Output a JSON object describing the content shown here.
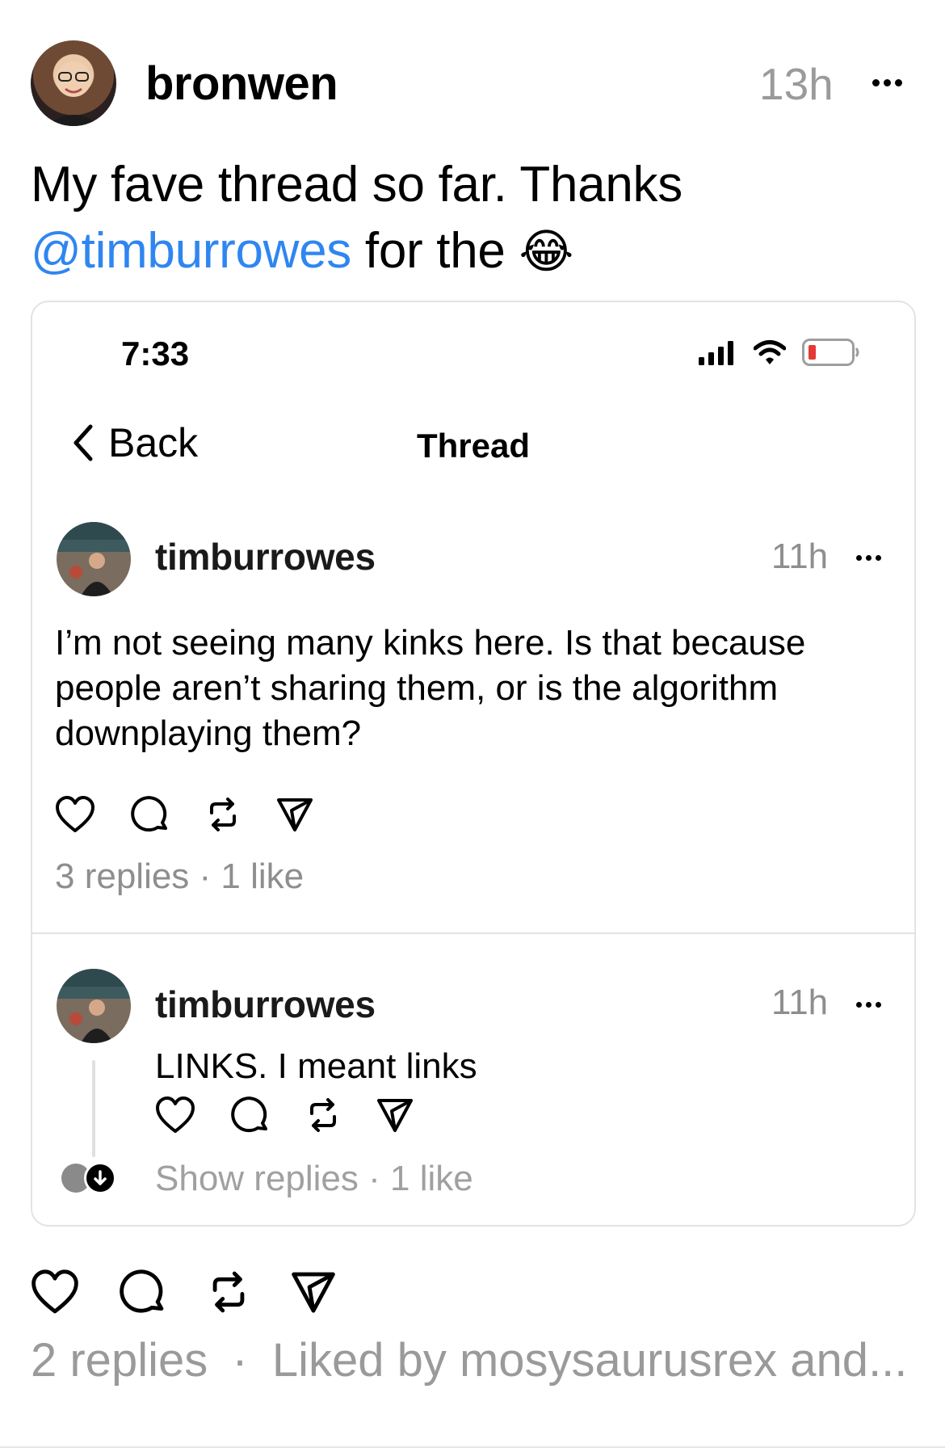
{
  "post": {
    "author": "bronwen",
    "time": "13h",
    "text_line1": "My fave thread so far. Thanks",
    "mention": "@timburrowes",
    "text_line2_rest": "for the",
    "emoji": "😂",
    "stats": {
      "replies": "2 replies",
      "separator": "·",
      "liked_by": "Liked by mosysaurusrex and..."
    }
  },
  "screenshot": {
    "status_time": "7:33",
    "nav": {
      "back_label": "Back",
      "title": "Thread"
    },
    "main_post": {
      "author": "timburrowes",
      "time": "11h",
      "text": [
        "I’m not seeing many kinks here. Is that because",
        "people aren’t sharing them, or is the algorithm",
        "downplaying them?"
      ],
      "meta": "3 replies · 1 like"
    },
    "reply": {
      "author": "timburrowes",
      "time": "11h",
      "text": "LINKS. I meant links",
      "meta": "Show replies · 1 like"
    }
  },
  "colors": {
    "mention": "#2f86f0",
    "muted": "#9a9a9a",
    "battery_low": "#e53935",
    "divider": "#e3e3e3"
  },
  "icons": [
    "heart-icon",
    "comment-icon",
    "repost-icon",
    "share-icon",
    "more-icon",
    "back-chevron-icon",
    "signal-icon",
    "wifi-icon",
    "battery-icon"
  ]
}
